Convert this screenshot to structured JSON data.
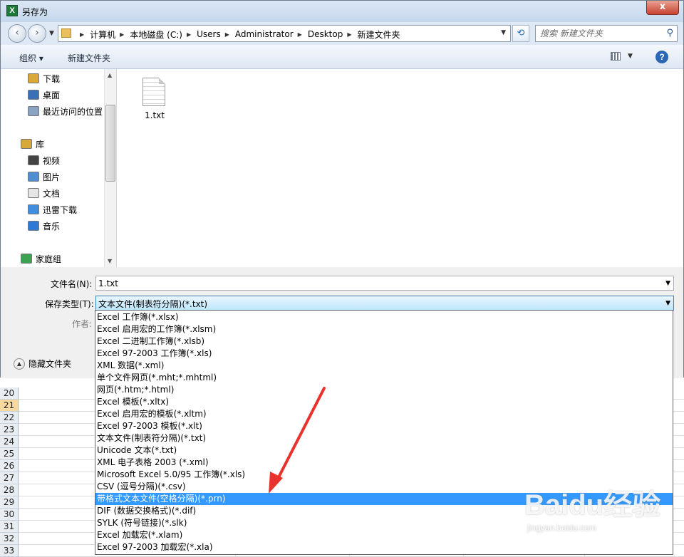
{
  "window": {
    "title": "另存为",
    "app_icon": "excel-icon",
    "close_label": "x"
  },
  "nav": {
    "back_label": "‹",
    "forward_label": "›",
    "breadcrumbs": [
      "计算机",
      "本地磁盘 (C:)",
      "Users",
      "Administrator",
      "Desktop",
      "新建文件夹"
    ],
    "search_placeholder": "搜索 新建文件夹"
  },
  "toolbar": {
    "organize_label": "组织 ▾",
    "new_folder_label": "新建文件夹",
    "help_label": "?"
  },
  "sidebar": {
    "items": [
      {
        "label": "下载",
        "icon": "download-folder-icon"
      },
      {
        "label": "桌面",
        "icon": "desktop-icon"
      },
      {
        "label": "最近访问的位置",
        "icon": "recent-places-icon"
      },
      {
        "label": "库",
        "icon": "library-icon"
      },
      {
        "label": "视频",
        "icon": "videos-icon"
      },
      {
        "label": "图片",
        "icon": "pictures-icon"
      },
      {
        "label": "文档",
        "icon": "documents-icon"
      },
      {
        "label": "迅雷下载",
        "icon": "thunder-download-icon"
      },
      {
        "label": "音乐",
        "icon": "music-icon"
      },
      {
        "label": "家庭组",
        "icon": "homegroup-icon"
      }
    ]
  },
  "files": [
    {
      "name": "1.txt",
      "icon": "text-file-icon"
    }
  ],
  "form": {
    "filename_label": "文件名(N):",
    "filename_value": "1.txt",
    "filetype_label": "保存类型(T):",
    "filetype_value": "文本文件(制表符分隔)(*.txt)",
    "author_label": "作者:",
    "hide_folders_label": "隐藏文件夹"
  },
  "filetype_options": [
    "Excel 工作簿(*.xlsx)",
    "Excel 启用宏的工作簿(*.xlsm)",
    "Excel 二进制工作簿(*.xlsb)",
    "Excel 97-2003 工作簿(*.xls)",
    "XML 数据(*.xml)",
    "单个文件网页(*.mht;*.mhtml)",
    "网页(*.htm;*.html)",
    "Excel 模板(*.xltx)",
    "Excel 启用宏的模板(*.xltm)",
    "Excel 97-2003 模板(*.xlt)",
    "文本文件(制表符分隔)(*.txt)",
    "Unicode 文本(*.txt)",
    "XML 电子表格 2003 (*.xml)",
    "Microsoft Excel 5.0/95 工作簿(*.xls)",
    "CSV (逗号分隔)(*.csv)",
    "带格式文本文件(空格分隔)(*.prn)",
    "DIF (数据交换格式)(*.dif)",
    "SYLK (符号链接)(*.slk)",
    "Excel 加载宏(*.xlam)",
    "Excel 97-2003 加载宏(*.xla)"
  ],
  "selected_option_index": 15,
  "sheet_rows": [
    "20",
    "21",
    "22",
    "23",
    "24",
    "25",
    "26",
    "27",
    "28",
    "29",
    "30",
    "31",
    "32",
    "33"
  ],
  "selected_row": "21",
  "annotation": {
    "color": "#e8322b"
  },
  "watermark": {
    "logo": "Baidu经验",
    "url": "jingyan.baidu.com"
  },
  "colors": {
    "selection": "#3399ff",
    "titlebar": "#c6d7ec"
  }
}
